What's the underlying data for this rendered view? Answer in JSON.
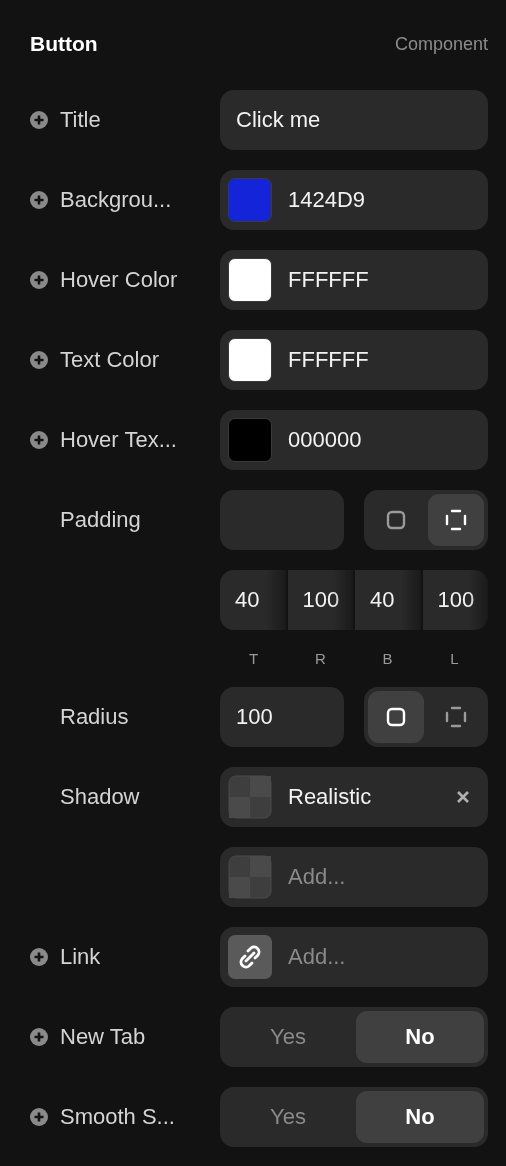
{
  "header": {
    "title": "Button",
    "subtitle": "Component"
  },
  "rows": [
    {
      "kind": "text",
      "label": "Title",
      "plus": true,
      "value": "Click me"
    },
    {
      "kind": "color",
      "label": "Backgrou...",
      "plus": true,
      "value": "1424D9",
      "color": "#1424d9"
    },
    {
      "kind": "color",
      "label": "Hover Color",
      "plus": true,
      "value": "FFFFFF",
      "color": "#ffffff"
    },
    {
      "kind": "color",
      "label": "Text Color",
      "plus": true,
      "value": "FFFFFF",
      "color": "#ffffff"
    },
    {
      "kind": "color",
      "label": "Hover Tex...",
      "plus": true,
      "value": "000000",
      "color": "#000000"
    },
    {
      "kind": "dimension",
      "label": "Padding",
      "plus": false,
      "modes": [
        {
          "kind": "uniform",
          "selected": false
        },
        {
          "kind": "individual",
          "selected": true
        }
      ],
      "sides": [
        {
          "value": "40",
          "label": "T"
        },
        {
          "value": "100",
          "label": "R"
        },
        {
          "value": "40",
          "label": "B"
        },
        {
          "value": "100",
          "label": "L"
        }
      ]
    },
    {
      "kind": "dimension",
      "label": "Radius",
      "plus": false,
      "value": "100",
      "modes": [
        {
          "kind": "uniform",
          "selected": true
        },
        {
          "kind": "individual",
          "selected": false
        }
      ]
    },
    {
      "kind": "shadow",
      "label": "Shadow",
      "plus": false,
      "value": "Realistic",
      "removable": true
    },
    {
      "kind": "shadow",
      "plus": false,
      "placeholder": "Add..."
    },
    {
      "kind": "link",
      "label": "Link",
      "plus": true,
      "placeholder": "Add..."
    },
    {
      "kind": "toggle",
      "label": "New Tab",
      "plus": true,
      "options": [
        {
          "label": "Yes",
          "selected": false
        },
        {
          "label": "No",
          "selected": true
        }
      ]
    },
    {
      "kind": "toggle",
      "label": "Smooth S...",
      "plus": true,
      "options": [
        {
          "label": "Yes",
          "selected": false
        },
        {
          "label": "No",
          "selected": true
        }
      ]
    }
  ]
}
